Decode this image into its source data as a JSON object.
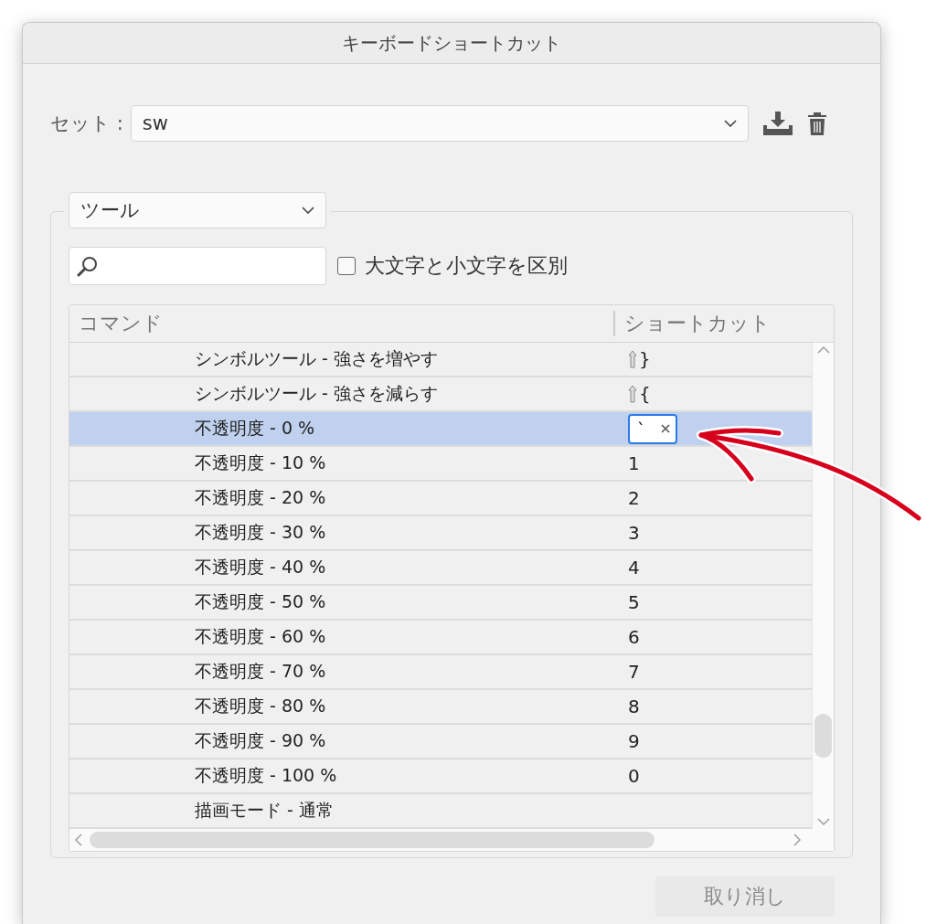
{
  "window": {
    "title": "キーボードショートカット"
  },
  "set": {
    "label": "セット :",
    "value": "sw"
  },
  "category": {
    "value": "ツール"
  },
  "case_sensitive": {
    "label": "大文字と小文字を区別",
    "checked": false
  },
  "table": {
    "columns": [
      "コマンド",
      "ショートカット"
    ],
    "rows": [
      {
        "command": "シンボルツール - 強さを増やす",
        "shift": true,
        "shortcut": "}",
        "selected": false,
        "editing": false
      },
      {
        "command": "シンボルツール - 強さを減らす",
        "shift": true,
        "shortcut": "{",
        "selected": false,
        "editing": false
      },
      {
        "command": "不透明度 - 0 %",
        "shift": false,
        "shortcut": "`",
        "selected": true,
        "editing": true
      },
      {
        "command": "不透明度 - 10 %",
        "shift": false,
        "shortcut": "1",
        "selected": false,
        "editing": false
      },
      {
        "command": "不透明度 - 20 %",
        "shift": false,
        "shortcut": "2",
        "selected": false,
        "editing": false
      },
      {
        "command": "不透明度 - 30 %",
        "shift": false,
        "shortcut": "3",
        "selected": false,
        "editing": false
      },
      {
        "command": "不透明度 - 40 %",
        "shift": false,
        "shortcut": "4",
        "selected": false,
        "editing": false
      },
      {
        "command": "不透明度 - 50 %",
        "shift": false,
        "shortcut": "5",
        "selected": false,
        "editing": false
      },
      {
        "command": "不透明度 - 60 %",
        "shift": false,
        "shortcut": "6",
        "selected": false,
        "editing": false
      },
      {
        "command": "不透明度 - 70 %",
        "shift": false,
        "shortcut": "7",
        "selected": false,
        "editing": false
      },
      {
        "command": "不透明度 - 80 %",
        "shift": false,
        "shortcut": "8",
        "selected": false,
        "editing": false
      },
      {
        "command": "不透明度 - 90 %",
        "shift": false,
        "shortcut": "9",
        "selected": false,
        "editing": false
      },
      {
        "command": "不透明度 - 100 %",
        "shift": false,
        "shortcut": "0",
        "selected": false,
        "editing": false
      },
      {
        "command": "描画モード - 通常",
        "shift": false,
        "selected": false,
        "editing": false
      }
    ]
  },
  "buttons": [
    {
      "label": "取り消し",
      "disabled": true
    }
  ]
}
